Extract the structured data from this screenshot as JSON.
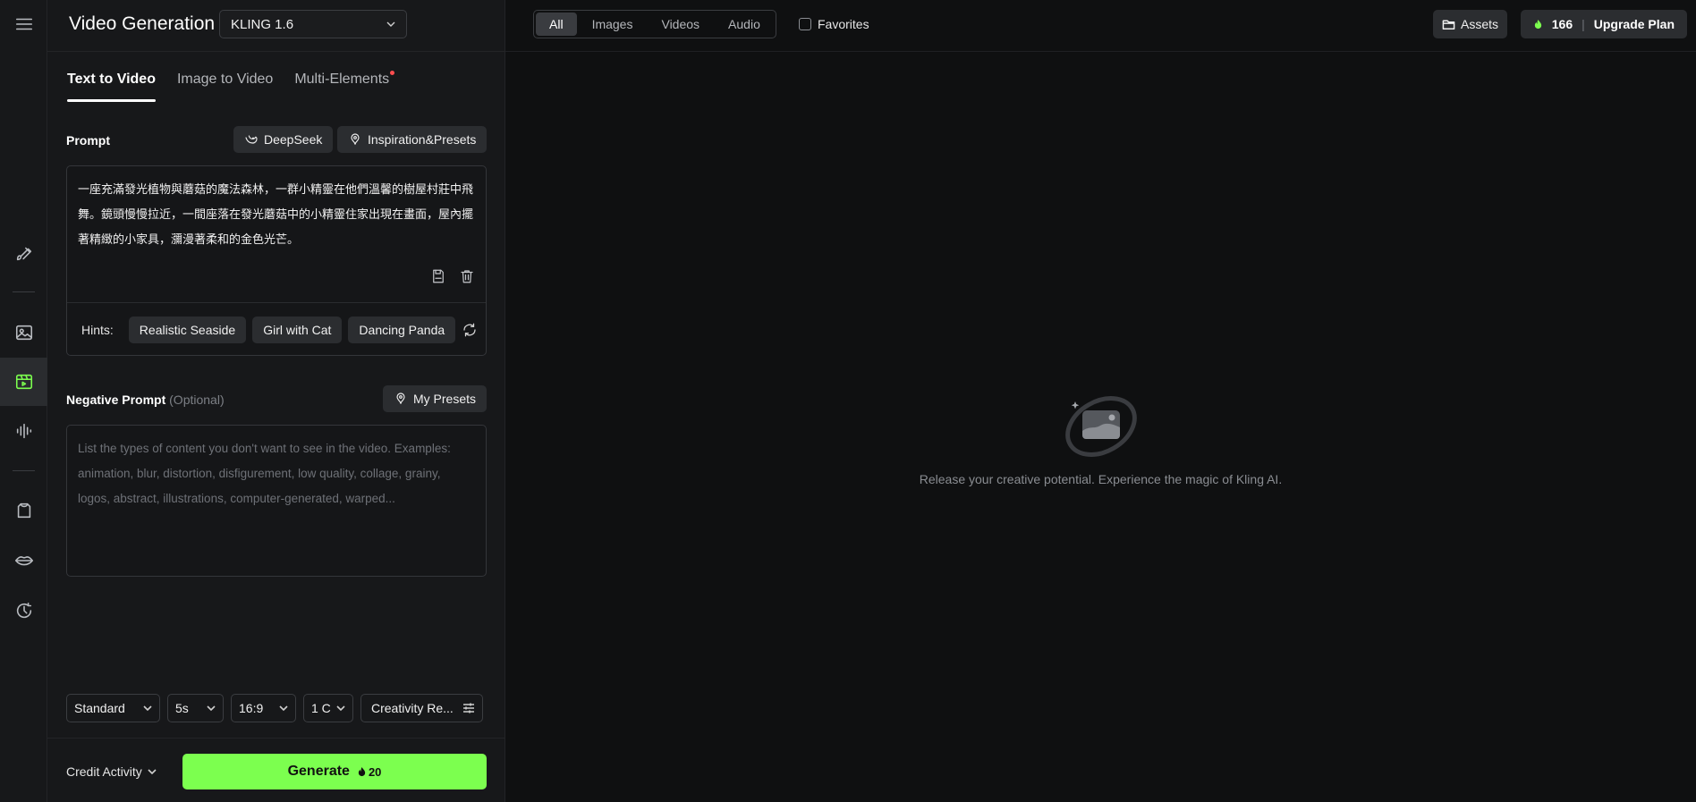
{
  "rail": {
    "icons": [
      "brush-icon",
      "image-icon",
      "video-icon",
      "audio-wave-icon",
      "clothing-icon",
      "lips-icon",
      "history-icon"
    ]
  },
  "header": {
    "title": "Video Generation",
    "model": "KLING 1.6"
  },
  "tabs": [
    {
      "label": "Text to Video",
      "active": true
    },
    {
      "label": "Image to Video",
      "active": false
    },
    {
      "label": "Multi-Elements",
      "active": false
    }
  ],
  "prompt": {
    "label": "Prompt",
    "deepseek_label": "DeepSeek",
    "presets_label": "Inspiration&Presets",
    "text": "一座充滿發光植物與蘑菇的魔法森林，一群小精靈在他們溫馨的樹屋村莊中飛舞。鏡頭慢慢拉近，一間座落在發光蘑菇中的小精靈住家出現在畫面，屋內擺著精緻的小家具，瀰漫著柔和的金色光芒。",
    "hints_label": "Hints:",
    "hints": [
      "Realistic Seaside",
      "Girl with Cat",
      "Dancing Panda"
    ]
  },
  "negative": {
    "label": "Negative Prompt",
    "optional": "(Optional)",
    "presets_label": "My Presets",
    "placeholder": "List the types of content you don't want to see in the video. Examples: animation, blur, distortion, disfigurement, low quality, collage, grainy, logos, abstract, illustrations, computer-generated, warped..."
  },
  "settings": {
    "mode": "Standard",
    "duration": "5s",
    "ratio": "16:9",
    "count": "1 C",
    "creativity": "Creativity Re..."
  },
  "footer": {
    "credit_label": "Credit Activity",
    "generate_label": "Generate",
    "generate_cost": "20"
  },
  "topbar": {
    "filters": [
      {
        "label": "All",
        "active": true
      },
      {
        "label": "Images",
        "active": false
      },
      {
        "label": "Videos",
        "active": false
      },
      {
        "label": "Audio",
        "active": false
      }
    ],
    "favorites_label": "Favorites",
    "assets_label": "Assets",
    "credits": "166",
    "upgrade_label": "Upgrade Plan"
  },
  "empty_state": {
    "message": "Release your creative potential. Experience the magic of Kling AI."
  },
  "colors": {
    "accent": "#7cff4f",
    "background": "#0f1011",
    "panel": "#17181a",
    "chip": "#2b2d30"
  }
}
